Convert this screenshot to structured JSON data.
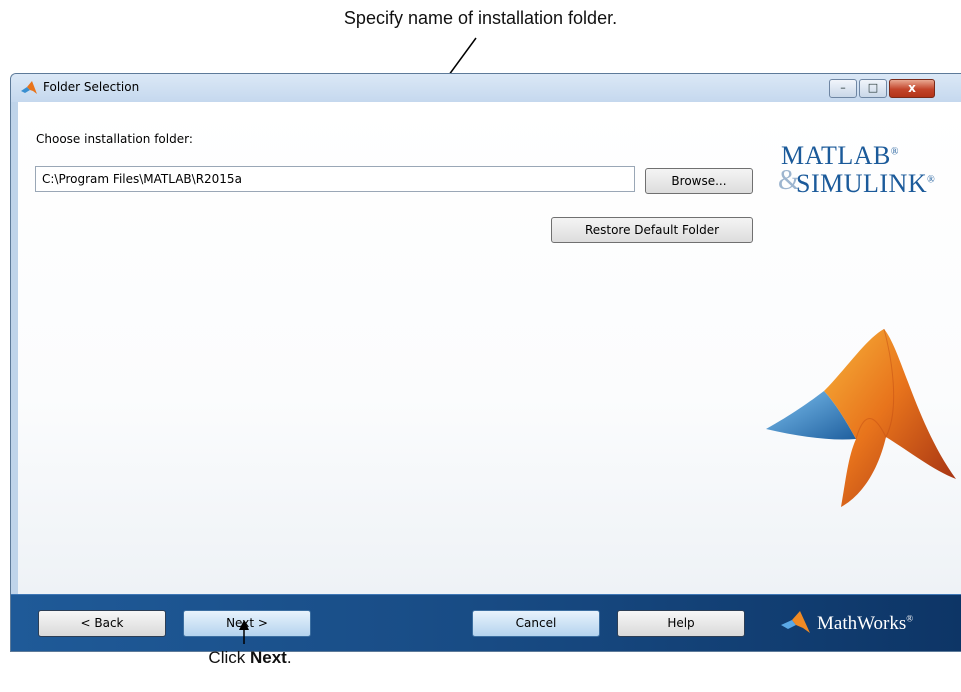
{
  "annotations": {
    "top_callout": "Specify name of installation folder.",
    "bottom_callout_prefix": "Click ",
    "bottom_callout_bold": "Next",
    "bottom_callout_suffix": "."
  },
  "window": {
    "title": "Folder Selection",
    "icon": "matlab-membrane-icon",
    "controls": {
      "minimize": "–",
      "maximize": "□",
      "close": "x"
    }
  },
  "form": {
    "label": "Choose installation folder:",
    "folder_value": "C:\\Program Files\\MATLAB\\R2015a",
    "browse_label": "Browse...",
    "restore_label": "Restore Default Folder"
  },
  "branding": {
    "line1": "MATLAB",
    "line1_mark": "®",
    "amp": "&",
    "line2": "SIMULINK",
    "line2_mark": "®",
    "footer_logo": "MathWorks",
    "footer_mark": "®"
  },
  "footer": {
    "back_label": "< Back",
    "next_label": "Next >",
    "cancel_label": "Cancel",
    "help_label": "Help"
  },
  "colors": {
    "footer_bg": "#1a4f8a",
    "brand_blue": "#1b5a9a",
    "membrane_orange": "#e8741c",
    "membrane_blue": "#3a8fd0"
  }
}
